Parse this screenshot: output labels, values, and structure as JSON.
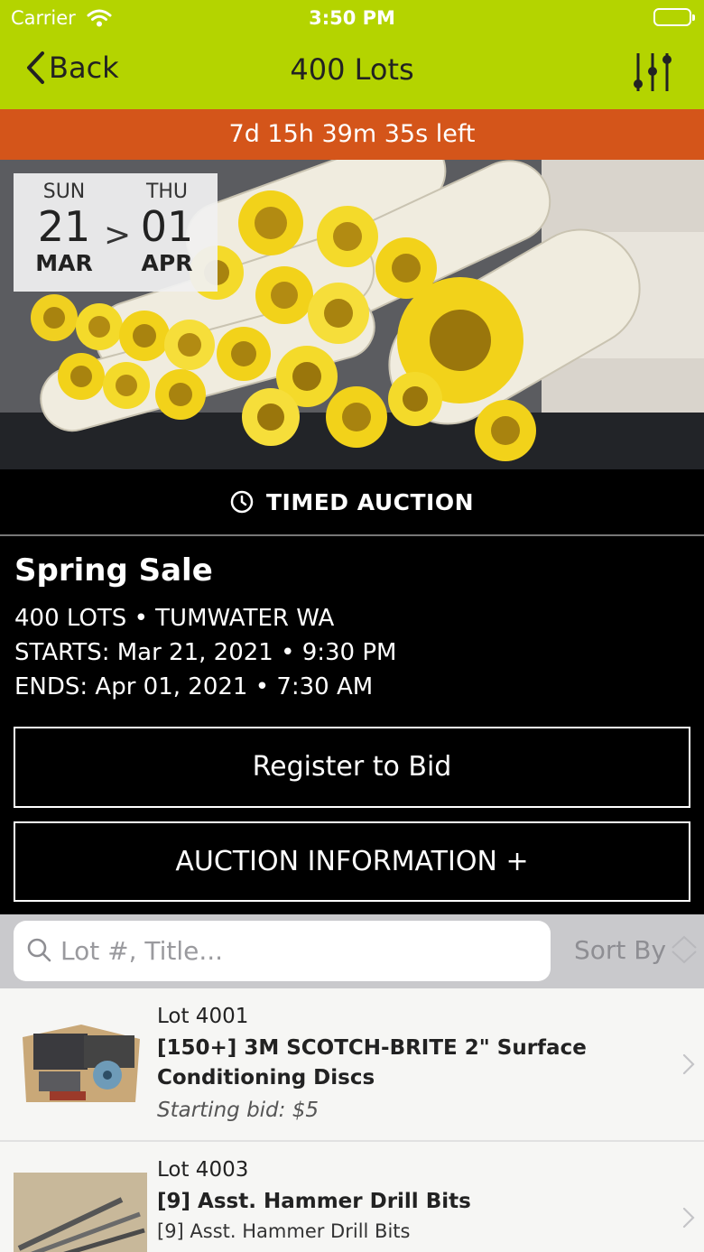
{
  "status_bar": {
    "carrier": "Carrier",
    "time": "3:50 PM"
  },
  "nav": {
    "back_label": "Back",
    "title": "400 Lots"
  },
  "timer": {
    "text": "7d 15h 39m 35s left"
  },
  "dates": {
    "start": {
      "dow": "SUN",
      "day": "21",
      "month": "MAR"
    },
    "separator": ">",
    "end": {
      "dow": "THU",
      "day": "01",
      "month": "APR"
    }
  },
  "auction_type": "TIMED AUCTION",
  "sale": {
    "name": "Spring Sale",
    "summary": "400 LOTS • TUMWATER WA",
    "starts": "STARTS: Mar 21, 2021 • 9:30 PM",
    "ends": "ENDS: Apr 01, 2021 • 7:30 AM"
  },
  "buttons": {
    "register": "Register to Bid",
    "auction_info": "AUCTION INFORMATION +"
  },
  "search": {
    "placeholder": "Lot #, Title...",
    "sort_label": "Sort By"
  },
  "lots": [
    {
      "lot": "Lot 4001",
      "title": "[150+] 3M SCOTCH-BRITE 2\" Surface Conditioning Discs",
      "bid": "Starting bid: $5"
    },
    {
      "lot": "Lot 4003",
      "title": "[9] Asst. Hammer Drill Bits",
      "subtitle": "[9] Asst. Hammer Drill Bits"
    }
  ],
  "colors": {
    "accent": "#b4d400",
    "timer": "#d4551a"
  }
}
